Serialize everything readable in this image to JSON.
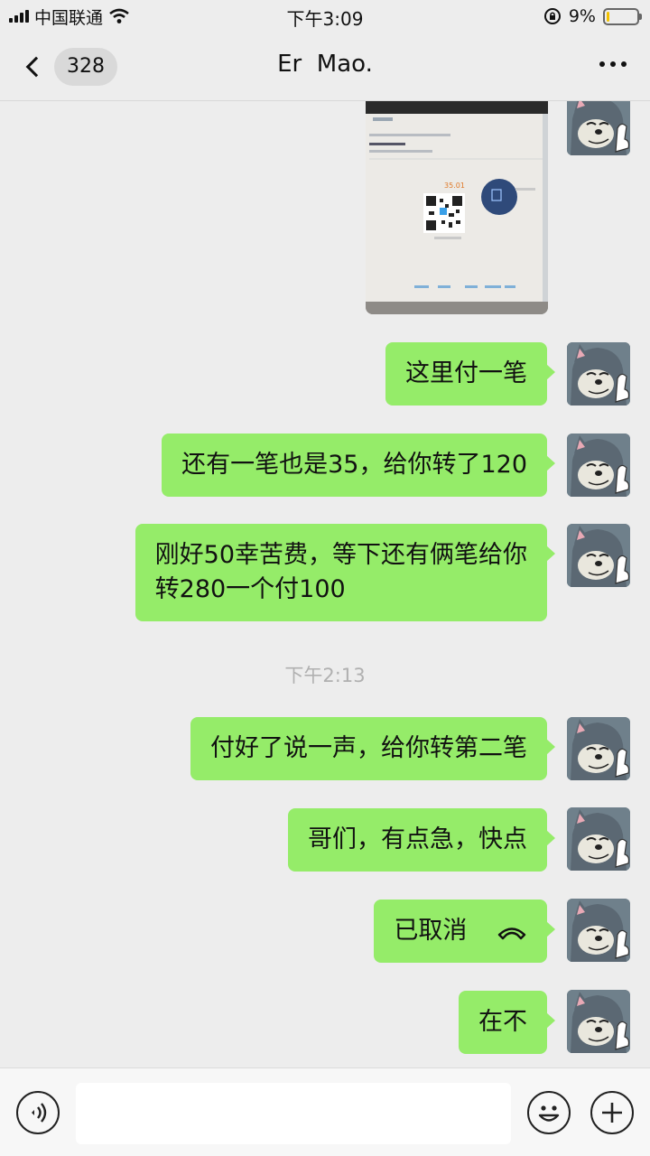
{
  "status_bar": {
    "carrier": "中国联通",
    "time": "下午3:09",
    "battery_percent": "9%",
    "battery_level": 0.09
  },
  "nav": {
    "back_count": "328",
    "title": "Er  Mao."
  },
  "messages": [
    {
      "type": "image",
      "qr_amount": "35.01"
    },
    {
      "type": "text",
      "lines": [
        "这里付一笔"
      ]
    },
    {
      "type": "text",
      "lines": [
        "还有一笔也是35，给你转了120"
      ]
    },
    {
      "type": "text",
      "lines": [
        "刚好50幸苦费，等下还有俩笔给你",
        "转280一个付100"
      ]
    },
    {
      "type": "timestamp",
      "text": "下午2:13"
    },
    {
      "type": "text",
      "lines": [
        "付好了说一声，给你转第二笔"
      ]
    },
    {
      "type": "text",
      "lines": [
        "哥们，有点急，快点"
      ]
    },
    {
      "type": "call",
      "text": "已取消"
    },
    {
      "type": "text",
      "lines": [
        "在不"
      ]
    }
  ],
  "colors": {
    "bubble": "#95ec69",
    "background": "#ededed"
  },
  "icons": [
    "wifi-icon",
    "orientation-lock-icon",
    "battery-icon",
    "voice-icon",
    "emoji-icon",
    "plus-icon",
    "hangup-icon"
  ]
}
